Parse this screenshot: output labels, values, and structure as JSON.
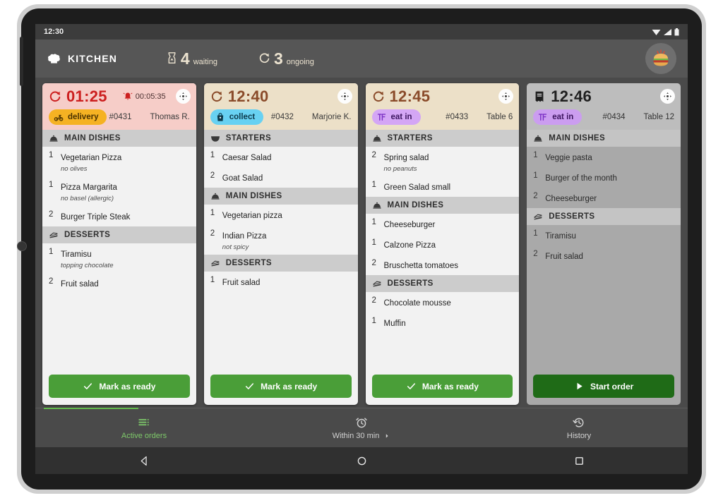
{
  "status_bar": {
    "time": "12:30",
    "icons": [
      "wifi-icon",
      "signal-icon",
      "battery-icon"
    ]
  },
  "header": {
    "brand": "KITCHEN",
    "brand_icon": "chef-hat-icon",
    "waiting": {
      "icon": "hourglass-icon",
      "count": "4",
      "label": "waiting"
    },
    "ongoing": {
      "icon": "refresh-icon",
      "count": "3",
      "label": "ongoing"
    },
    "avatar_icon": "burger-avatar-icon"
  },
  "colors": {
    "accent_green": "#4a9e38",
    "start_green": "#1f6b17",
    "urgent_red": "#cc1f1f",
    "warm_brown": "#8a4b2a",
    "delivery_amber": "#f5b223",
    "collect_blue": "#68d1f2",
    "eatin_purple": "#d4a6f5",
    "screen_bg": "#4a4a4a",
    "header_bg": "#565656"
  },
  "orders": [
    {
      "state": "urgent",
      "timer_icon": "refresh-icon",
      "timer": "01:25",
      "alarm_icon": "bell-icon",
      "alarm_time": "00:05:35",
      "expand_icon": "expand-move-icon",
      "type_badge": {
        "label": "delivery",
        "icon": "scooter-icon",
        "kind": "delivery"
      },
      "order_number": "#0431",
      "customer": "Thomas R.",
      "sections": [
        {
          "title": "MAIN DISHES",
          "icon": "cloche-icon",
          "items": [
            {
              "qty": "1",
              "name": "Vegetarian Pizza",
              "note": "no olives"
            },
            {
              "qty": "1",
              "name": "Pizza Margarita",
              "note": "no basel (allergic)"
            },
            {
              "qty": "2",
              "name": "Burger Triple Steak",
              "note": ""
            }
          ]
        },
        {
          "title": "DESSERTS",
          "icon": "cake-icon",
          "items": [
            {
              "qty": "1",
              "name": "Tiramisu",
              "note": "topping chocolate"
            },
            {
              "qty": "2",
              "name": "Fruit salad",
              "note": ""
            }
          ]
        }
      ],
      "action": {
        "label": "Mark as ready",
        "icon": "check-icon",
        "kind": "ready"
      }
    },
    {
      "state": "warm",
      "timer_icon": "refresh-icon",
      "timer": "12:40",
      "alarm_icon": "",
      "alarm_time": "",
      "expand_icon": "expand-move-icon",
      "type_badge": {
        "label": "collect",
        "icon": "bag-icon",
        "kind": "collect"
      },
      "order_number": "#0432",
      "customer": "Marjorie K.",
      "sections": [
        {
          "title": "STARTERS",
          "icon": "bowl-icon",
          "items": [
            {
              "qty": "1",
              "name": "Caesar Salad",
              "note": ""
            },
            {
              "qty": "2",
              "name": "Goat Salad",
              "note": ""
            }
          ]
        },
        {
          "title": "MAIN DISHES",
          "icon": "cloche-icon",
          "items": [
            {
              "qty": "1",
              "name": "Vegetarian pizza",
              "note": ""
            },
            {
              "qty": "2",
              "name": "Indian Pizza",
              "note": "not spicy"
            }
          ]
        },
        {
          "title": "DESSERTS",
          "icon": "cake-icon",
          "items": [
            {
              "qty": "1",
              "name": "Fruit salad",
              "note": ""
            }
          ]
        }
      ],
      "action": {
        "label": "Mark as ready",
        "icon": "check-icon",
        "kind": "ready"
      }
    },
    {
      "state": "warm",
      "timer_icon": "refresh-icon",
      "timer": "12:45",
      "alarm_icon": "",
      "alarm_time": "",
      "expand_icon": "expand-move-icon",
      "type_badge": {
        "label": "eat in",
        "icon": "table-icon",
        "kind": "eatin"
      },
      "order_number": "#0433",
      "customer": "Table 6",
      "sections": [
        {
          "title": "STARTERS",
          "icon": "cloche-icon",
          "items": [
            {
              "qty": "2",
              "name": "Spring salad",
              "note": "no peanuts"
            },
            {
              "qty": "1",
              "name": "Green Salad small",
              "note": ""
            }
          ]
        },
        {
          "title": "MAIN DISHES",
          "icon": "cloche-icon",
          "items": [
            {
              "qty": "1",
              "name": "Cheeseburger",
              "note": ""
            },
            {
              "qty": "1",
              "name": "Calzone Pizza",
              "note": ""
            },
            {
              "qty": "2",
              "name": "Bruschetta tomatoes",
              "note": ""
            }
          ]
        },
        {
          "title": "DESSERTS",
          "icon": "cake-icon",
          "items": [
            {
              "qty": "2",
              "name": "Chocolate mousse",
              "note": ""
            },
            {
              "qty": "1",
              "name": "Muffin",
              "note": ""
            }
          ]
        }
      ],
      "action": {
        "label": "Mark as ready",
        "icon": "check-icon",
        "kind": "ready"
      }
    },
    {
      "state": "pending",
      "timer_icon": "receipt-icon",
      "timer": "12:46",
      "alarm_icon": "",
      "alarm_time": "",
      "expand_icon": "expand-move-icon",
      "type_badge": {
        "label": "eat in",
        "icon": "table-icon",
        "kind": "eatin"
      },
      "order_number": "#0434",
      "customer": "Table 12",
      "sections": [
        {
          "title": "MAIN DISHES",
          "icon": "cloche-icon",
          "items": [
            {
              "qty": "1",
              "name": "Veggie pasta",
              "note": ""
            },
            {
              "qty": "1",
              "name": "Burger of the month",
              "note": ""
            },
            {
              "qty": "2",
              "name": "Cheeseburger",
              "note": ""
            }
          ]
        },
        {
          "title": "DESSERTS",
          "icon": "cake-icon",
          "items": [
            {
              "qty": "1",
              "name": "Tiramisu",
              "note": ""
            },
            {
              "qty": "2",
              "name": "Fruit salad",
              "note": ""
            }
          ]
        }
      ],
      "action": {
        "label": "Start order",
        "icon": "play-icon",
        "kind": "start"
      }
    }
  ],
  "tabs": [
    {
      "label": "Active orders",
      "icon": "list-icon",
      "active": true,
      "chevron": false
    },
    {
      "label": "Within 30 min",
      "icon": "alarm-clock-icon",
      "active": false,
      "chevron": true
    },
    {
      "label": "History",
      "icon": "history-icon",
      "active": false,
      "chevron": false
    }
  ],
  "nav_bar": {
    "back": "back-triangle-icon",
    "home": "home-circle-icon",
    "recents": "recents-square-icon"
  }
}
